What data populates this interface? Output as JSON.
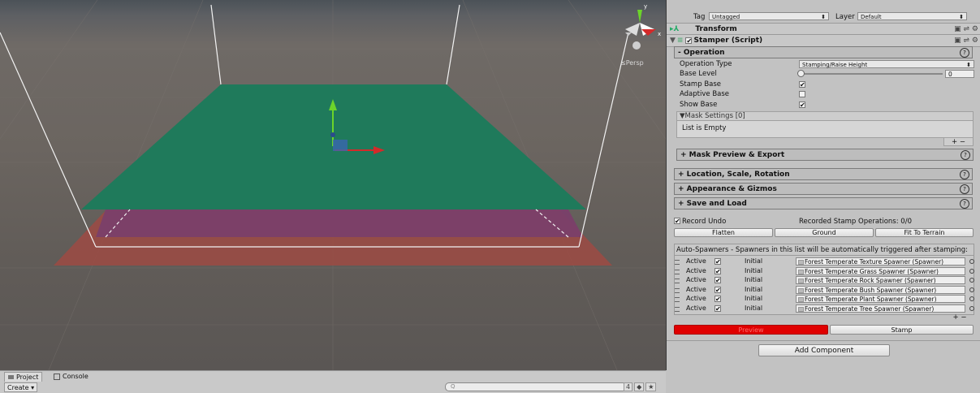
{
  "scene": {
    "persp_label": "≤Persp"
  },
  "project_bar": {
    "tabs": [
      {
        "label": "Project",
        "icon": "folder-icon"
      },
      {
        "label": "Console",
        "icon": "console-icon"
      }
    ],
    "create_label": "Create ▾",
    "search_placeholder": "Q",
    "counter": "4"
  },
  "inspector": {
    "tag_label": "Tag",
    "tag_value": "Untagged",
    "layer_label": "Layer",
    "layer_value": "Default",
    "components": {
      "transform": "Transform",
      "stamper": "Stamper (Script)"
    },
    "operation": {
      "header": "- Operation",
      "fields": [
        {
          "label": "Operation Type"
        },
        {
          "label": "Base Level"
        },
        {
          "label": "Stamp Base"
        },
        {
          "label": "Adaptive Base"
        },
        {
          "label": "Show Base"
        }
      ],
      "operation_type_value": "Stamping/Raise Height",
      "base_level_value": "0",
      "mask_settings_label": "▼Mask Settings [0]",
      "list_empty": "List is Empty",
      "plus_minus": "+  −"
    },
    "sections": {
      "mask_preview": "+ Mask Preview & Export",
      "location": "+ Location, Scale, Rotation",
      "appearance": "+ Appearance & Gizmos",
      "save_load": "+ Save and Load"
    },
    "record_undo_label": "Record Undo",
    "recorded_ops": "Recorded Stamp Operations: 0/0",
    "buttons": {
      "flatten": "Flatten",
      "ground": "Ground",
      "fit_to_terrain": "Fit To Terrain",
      "preview": "Preview",
      "stamp": "Stamp",
      "add_component": "Add Component"
    },
    "auto_spawners_desc": "Auto-Spawners - Spawners in this list will be automatically triggered after stamping:",
    "spawners": [
      {
        "active": "Active",
        "mode": "Initial",
        "name": "Forest Temperate Texture Spawner (Spawner)"
      },
      {
        "active": "Active",
        "mode": "Initial",
        "name": "Forest Temperate Grass Spawner (Spawner)"
      },
      {
        "active": "Active",
        "mode": "Initial",
        "name": "Forest Temperate Rock Spawner (Spawner)"
      },
      {
        "active": "Active",
        "mode": "Initial",
        "name": "Forest Temperate Bush Spawner (Spawner)"
      },
      {
        "active": "Active",
        "mode": "Initial",
        "name": "Forest Temperate Plant Spawner (Spawner)"
      },
      {
        "active": "Active",
        "mode": "Initial",
        "name": "Forest Temperate Tree Spawner (Spawner)"
      }
    ],
    "spawner_plus_minus": "+  −"
  },
  "colors": {
    "green_plane": "#1f7a5b",
    "purple_plane": "#7a3f6a",
    "red_plane": "#9a4b45",
    "preview_button": "#e00000"
  }
}
